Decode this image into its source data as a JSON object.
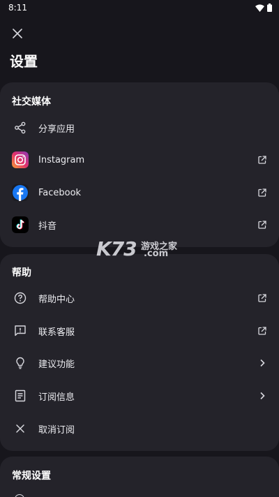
{
  "status_bar": {
    "time": "8:11",
    "wifi_icon": "wifi-icon",
    "battery_icon": "battery-icon"
  },
  "header": {
    "close_icon": "close-icon",
    "title": "设置"
  },
  "social": {
    "title": "社交媒体",
    "items": [
      {
        "label": "分享应用",
        "icon": "share-icon",
        "trail": ""
      },
      {
        "label": "Instagram",
        "icon": "instagram-icon",
        "trail": "external-link-icon"
      },
      {
        "label": "Facebook",
        "icon": "facebook-icon",
        "trail": "external-link-icon"
      },
      {
        "label": "抖音",
        "icon": "tiktok-icon",
        "trail": "external-link-icon"
      }
    ]
  },
  "help": {
    "title": "帮助",
    "items": [
      {
        "label": "帮助中心",
        "icon": "help-circle-icon",
        "trail": "external-link-icon"
      },
      {
        "label": "联系客服",
        "icon": "feedback-icon",
        "trail": "external-link-icon"
      },
      {
        "label": "建议功能",
        "icon": "lightbulb-icon",
        "trail": "chevron-right-icon"
      },
      {
        "label": "订阅信息",
        "icon": "document-icon",
        "trail": "chevron-right-icon"
      },
      {
        "label": "取消订阅",
        "icon": "close-icon",
        "trail": ""
      }
    ]
  },
  "general": {
    "title": "常规设置"
  },
  "watermark": {
    "brand": "K73",
    "text_top": "游戏之家",
    "text_bottom": ".com"
  },
  "colors": {
    "background": "#17161c",
    "card": "#24232a",
    "facebook": "#1877f2",
    "instagram_start": "#f9a035",
    "instagram_end": "#c02f8b"
  }
}
